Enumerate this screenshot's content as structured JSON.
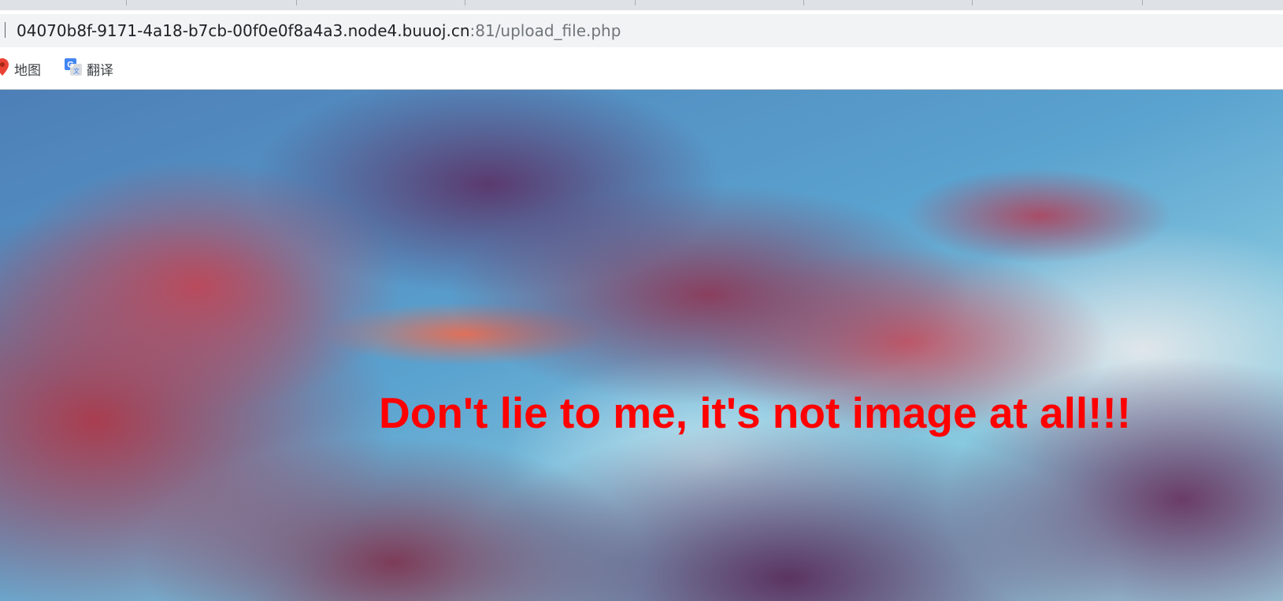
{
  "browser": {
    "address_bar": {
      "host": "04070b8f-9171-4a18-b7cb-00f0e0f8a4a3.node4.buuoj.cn",
      "port_and_path": ":81/upload_file.php"
    },
    "bookmarks": [
      {
        "label": "地图",
        "icon": "maps-pin-icon"
      },
      {
        "label": "翻译",
        "icon": "google-translate-icon"
      }
    ]
  },
  "page": {
    "background": "sky-clouds-image",
    "message": "Don't lie to me, it's not image at all!!!",
    "message_color": "#ff0000"
  }
}
